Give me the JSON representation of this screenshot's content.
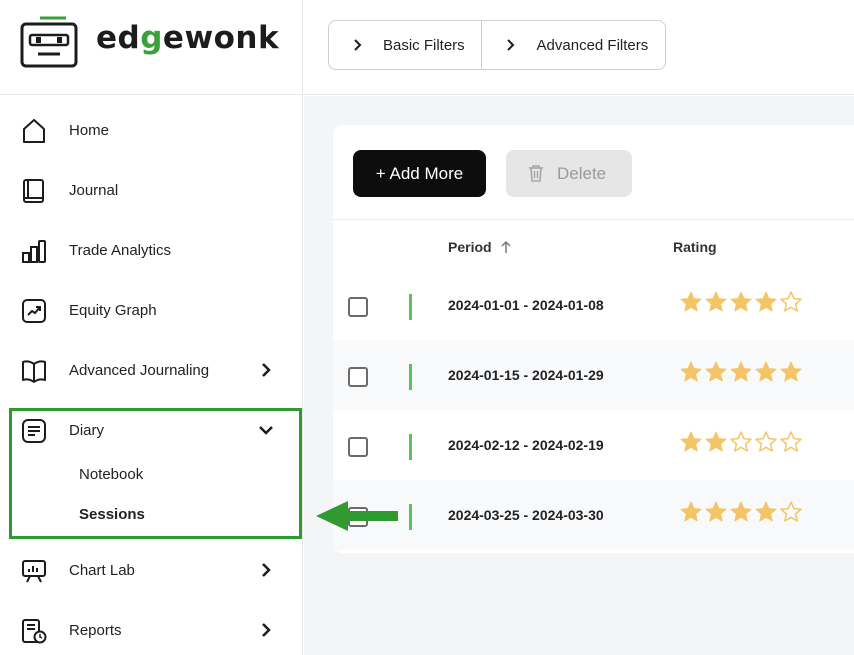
{
  "brand": {
    "name_pre": "ed",
    "name_g": "g",
    "name_post": "ewonk",
    "accent": "#3aa03a"
  },
  "sidebar": {
    "items": [
      {
        "label": "Home",
        "icon": "home-icon"
      },
      {
        "label": "Journal",
        "icon": "book-icon"
      },
      {
        "label": "Trade Analytics",
        "icon": "bar-chart-icon"
      },
      {
        "label": "Equity Graph",
        "icon": "trend-up-icon"
      },
      {
        "label": "Advanced Journaling",
        "icon": "open-book-icon"
      },
      {
        "label": "Diary",
        "icon": "document-icon"
      },
      {
        "label": "Chart Lab",
        "icon": "presentation-chart-icon"
      },
      {
        "label": "Reports",
        "icon": "report-clock-icon"
      }
    ],
    "diary_sub": [
      {
        "label": "Notebook",
        "active": false
      },
      {
        "label": "Sessions",
        "active": true
      }
    ]
  },
  "topbar": {
    "basic_filters": "Basic Filters",
    "advanced_filters": "Advanced Filters"
  },
  "toolbar": {
    "add_label": "+ Add More",
    "delete_label": "Delete"
  },
  "table": {
    "headers": {
      "period": "Period",
      "rating": "Rating"
    },
    "rows": [
      {
        "period": "2024-01-01 - 2024-01-08",
        "rating": 4
      },
      {
        "period": "2024-01-15 - 2024-01-29",
        "rating": 5
      },
      {
        "period": "2024-02-12 - 2024-02-19",
        "rating": 2
      },
      {
        "period": "2024-03-25 - 2024-03-30",
        "rating": 4
      }
    ]
  },
  "colors": {
    "star": "#f3c567",
    "highlight": "#2f9a2f",
    "row_bar": "#5cc15c"
  }
}
